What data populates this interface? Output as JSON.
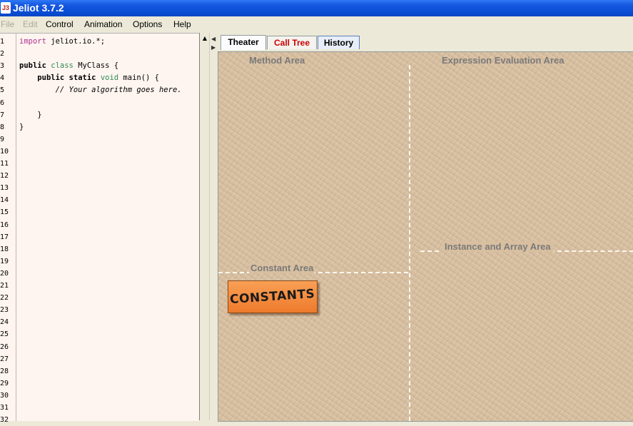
{
  "window": {
    "title": "Jeliot 3.7.2",
    "icon_text": "J3"
  },
  "menubar": {
    "items": [
      "File",
      "Edit",
      "Control",
      "Animation",
      "Options",
      "Help"
    ]
  },
  "editor": {
    "line_numbers": [
      "1",
      "2",
      "3",
      "4",
      "5",
      "6",
      "7",
      "8",
      "9",
      "10",
      "11",
      "12",
      "13",
      "14",
      "15",
      "16",
      "17",
      "18",
      "19",
      "20",
      "21",
      "22",
      "23",
      "24",
      "25",
      "26",
      "27",
      "28",
      "29",
      "30",
      "31",
      "32"
    ],
    "lines": [
      [
        "import",
        " jeliot.io.*;"
      ],
      [],
      [
        "public",
        " ",
        "class",
        " MyClass {"
      ],
      [
        "    ",
        "public static",
        " ",
        "void",
        " main() {"
      ],
      [
        "        ",
        "// Your algorithm goes here."
      ],
      [],
      [
        "    }"
      ],
      [
        "}"
      ]
    ]
  },
  "tabs": [
    {
      "label": "Theater"
    },
    {
      "label": "Call Tree"
    },
    {
      "label": "History"
    }
  ],
  "theater": {
    "method_area": "Method Area",
    "expression_area": "Expression Evaluation Area",
    "instance_area": "Instance and Array Area",
    "constant_area": "Constant Area",
    "constants_label": "CONSTANTS"
  },
  "colors": {
    "title_bar": "#0a4fd6",
    "editor_bg": "#fff5f0",
    "theater_bg": "#d8bfa0",
    "call_tree_tab_text": "#cc0000",
    "constants_block": "#ee7a2c"
  }
}
